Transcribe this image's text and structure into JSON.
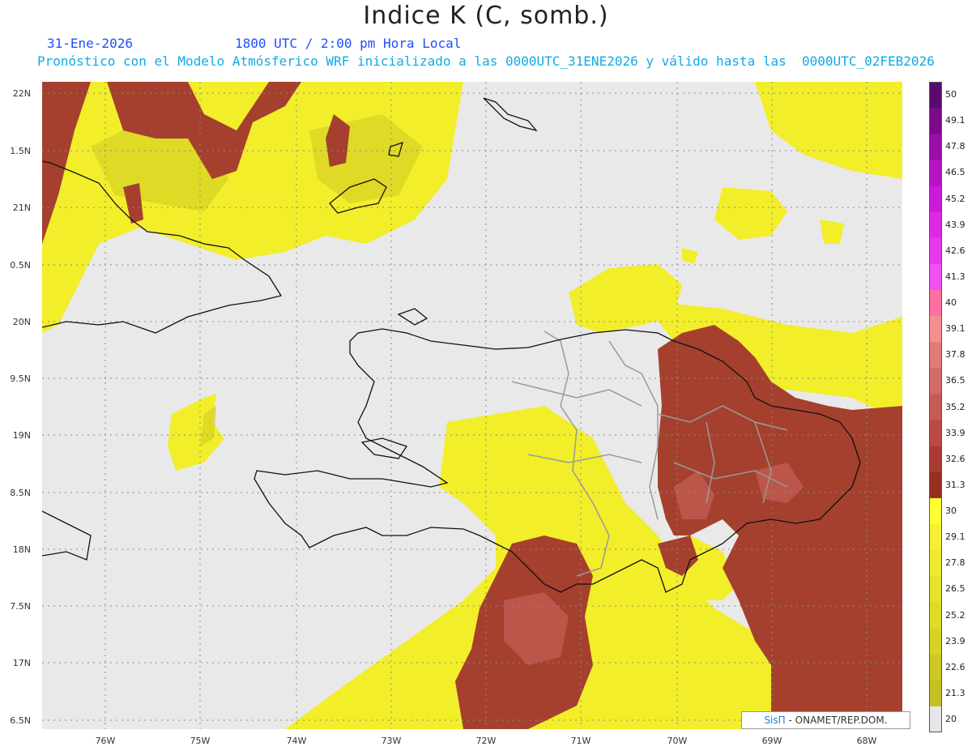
{
  "title": "Indice K (C, somb.)",
  "header": {
    "date": "31-Ene-2026",
    "time": "1800 UTC / 2:00 pm Hora Local",
    "model_line": "Pronóstico con el Modelo Atmósferico WRF inicializado a las 0000UTC_31ENE2026 y válido hasta las  0000UTC_02FEB2026"
  },
  "axes": {
    "lat_labels": [
      "22N",
      "1.5N",
      "21N",
      "0.5N",
      "20N",
      "9.5N",
      "19N",
      "8.5N",
      "18N",
      "7.5N",
      "17N",
      "6.5N"
    ],
    "lon_labels": [
      "76W",
      "75W",
      "74W",
      "73W",
      "72W",
      "71W",
      "70W",
      "69W",
      "68W"
    ]
  },
  "colorbar": {
    "labels": [
      "50",
      "49.1",
      "47.8",
      "46.5",
      "45.2",
      "43.9",
      "42.6",
      "41.3",
      "40",
      "39.1",
      "37.8",
      "36.5",
      "35.2",
      "33.9",
      "32.6",
      "31.3",
      "30",
      "29.1",
      "27.8",
      "26.5",
      "25.2",
      "23.9",
      "22.6",
      "21.3",
      "20"
    ],
    "colors": [
      "#5a0a6e",
      "#7a0a8a",
      "#9a0fa8",
      "#b614c2",
      "#cc1ad8",
      "#dd28e6",
      "#e838ee",
      "#f050f4",
      "#ff6fa0",
      "#f29090",
      "#e07b78",
      "#d26b66",
      "#c65b55",
      "#b94a44",
      "#a93b33",
      "#983020",
      "#ffff33",
      "#f6f033",
      "#eeea2d",
      "#e6e12a",
      "#dedb27",
      "#d6d226",
      "#cdc823",
      "#c4c022",
      "#e6e6e6"
    ]
  },
  "colors": {
    "no_data": "#e9e9e9",
    "yellow": "#f4f02a",
    "yellow_dark": "#dedc28",
    "brown": "#a5402e",
    "brown_light": "#c05b4f",
    "grid": "#8a8a8a",
    "coast": "#111111",
    "border": "#9a9a9a"
  },
  "credit": {
    "brand": "SisΠ",
    "text": "- ONAMET/REP.DOM."
  }
}
